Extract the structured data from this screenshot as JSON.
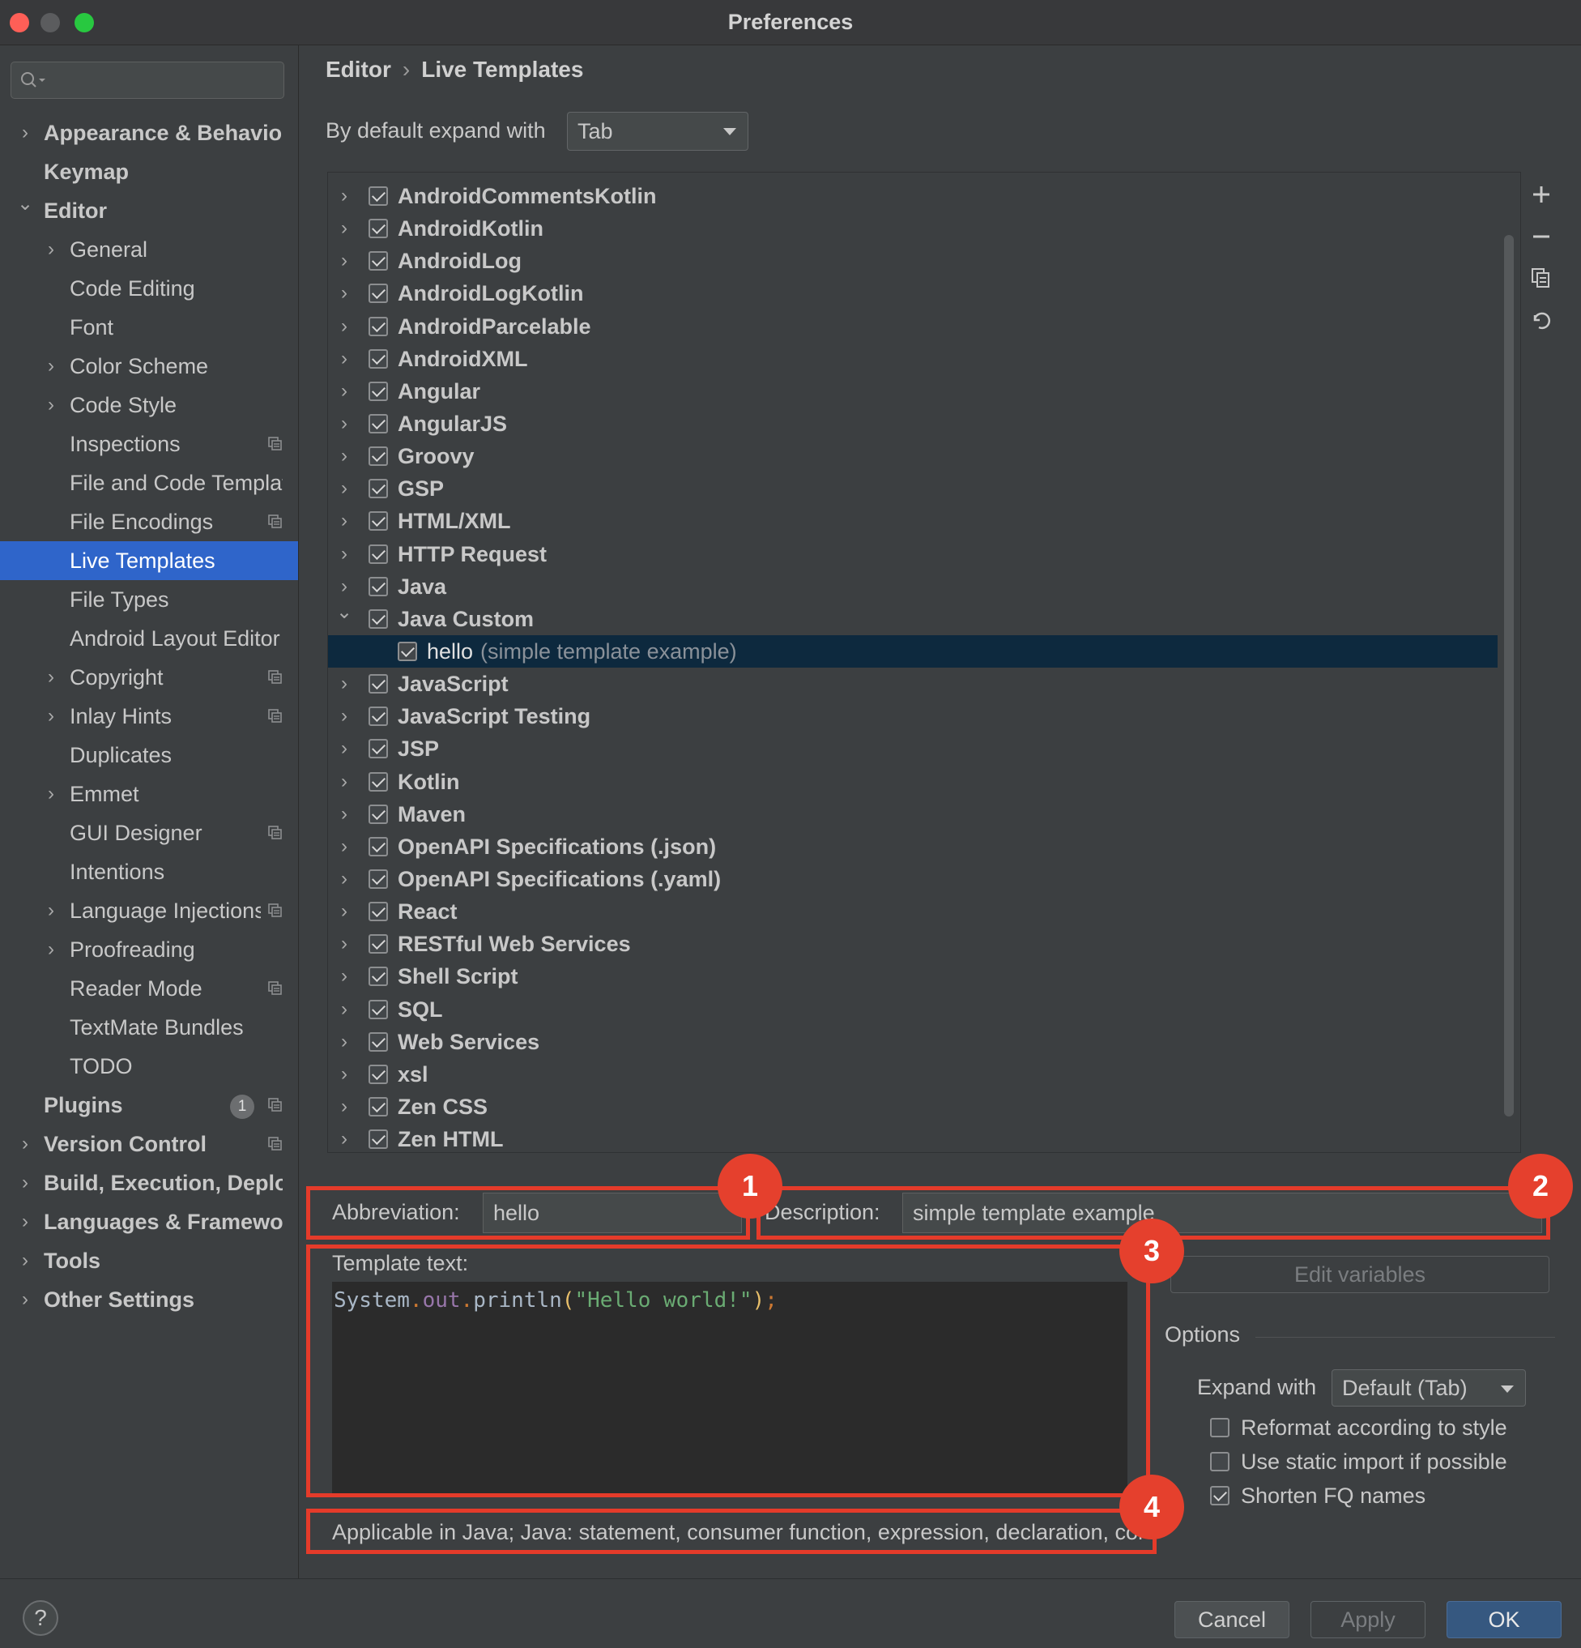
{
  "window": {
    "title": "Preferences",
    "colors": {
      "close": "#fe5f57",
      "minimize": "#febc2e",
      "maximize": "#28c840",
      "selection": "#2f65ca",
      "annotation": "#e53b2a",
      "primary_button": "#365880"
    }
  },
  "sidebar": {
    "search_placeholder": "",
    "items": [
      {
        "label": "Appearance & Behavior",
        "depth": 0,
        "bold": true,
        "chevron": "right"
      },
      {
        "label": "Keymap",
        "depth": 0,
        "bold": true
      },
      {
        "label": "Editor",
        "depth": 0,
        "bold": true,
        "chevron": "down"
      },
      {
        "label": "General",
        "depth": 1,
        "chevron": "right"
      },
      {
        "label": "Code Editing",
        "depth": 1
      },
      {
        "label": "Font",
        "depth": 1
      },
      {
        "label": "Color Scheme",
        "depth": 1,
        "chevron": "right"
      },
      {
        "label": "Code Style",
        "depth": 1,
        "chevron": "right"
      },
      {
        "label": "Inspections",
        "depth": 1,
        "icon": "project-settings-icon"
      },
      {
        "label": "File and Code Templates",
        "depth": 1
      },
      {
        "label": "File Encodings",
        "depth": 1,
        "icon": "project-settings-icon"
      },
      {
        "label": "Live Templates",
        "depth": 1,
        "selected": true
      },
      {
        "label": "File Types",
        "depth": 1
      },
      {
        "label": "Android Layout Editor",
        "depth": 1
      },
      {
        "label": "Copyright",
        "depth": 1,
        "chevron": "right",
        "icon": "project-settings-icon"
      },
      {
        "label": "Inlay Hints",
        "depth": 1,
        "chevron": "right",
        "icon": "project-settings-icon"
      },
      {
        "label": "Duplicates",
        "depth": 1
      },
      {
        "label": "Emmet",
        "depth": 1,
        "chevron": "right"
      },
      {
        "label": "GUI Designer",
        "depth": 1,
        "icon": "project-settings-icon"
      },
      {
        "label": "Intentions",
        "depth": 1
      },
      {
        "label": "Language Injections",
        "depth": 1,
        "chevron": "right",
        "icon": "project-settings-icon"
      },
      {
        "label": "Proofreading",
        "depth": 1,
        "chevron": "right"
      },
      {
        "label": "Reader Mode",
        "depth": 1,
        "icon": "project-settings-icon"
      },
      {
        "label": "TextMate Bundles",
        "depth": 1
      },
      {
        "label": "TODO",
        "depth": 1
      },
      {
        "label": "Plugins",
        "depth": 0,
        "bold": true,
        "badge": "1",
        "icon": "project-settings-icon"
      },
      {
        "label": "Version Control",
        "depth": 0,
        "bold": true,
        "chevron": "right",
        "icon": "project-settings-icon"
      },
      {
        "label": "Build, Execution, Deployment",
        "depth": 0,
        "bold": true,
        "chevron": "right"
      },
      {
        "label": "Languages & Frameworks",
        "depth": 0,
        "bold": true,
        "chevron": "right"
      },
      {
        "label": "Tools",
        "depth": 0,
        "bold": true,
        "chevron": "right"
      },
      {
        "label": "Other Settings",
        "depth": 0,
        "bold": true,
        "chevron": "right"
      }
    ]
  },
  "breadcrumb": {
    "parent": "Editor",
    "separator": "›",
    "current": "Live Templates"
  },
  "expand_default": {
    "label": "By default expand with",
    "value": "Tab"
  },
  "template_groups": [
    {
      "name": "AndroidCommentsKotlin",
      "checked": true
    },
    {
      "name": "AndroidKotlin",
      "checked": true
    },
    {
      "name": "AndroidLog",
      "checked": true
    },
    {
      "name": "AndroidLogKotlin",
      "checked": true
    },
    {
      "name": "AndroidParcelable",
      "checked": true
    },
    {
      "name": "AndroidXML",
      "checked": true
    },
    {
      "name": "Angular",
      "checked": true
    },
    {
      "name": "AngularJS",
      "checked": true
    },
    {
      "name": "Groovy",
      "checked": true
    },
    {
      "name": "GSP",
      "checked": true
    },
    {
      "name": "HTML/XML",
      "checked": true
    },
    {
      "name": "HTTP Request",
      "checked": true
    },
    {
      "name": "Java",
      "checked": true
    },
    {
      "name": "Java Custom",
      "checked": true,
      "expanded": true,
      "children": [
        {
          "abbr": "hello",
          "desc": "(simple template example)",
          "checked": true,
          "selected": true
        }
      ]
    },
    {
      "name": "JavaScript",
      "checked": true
    },
    {
      "name": "JavaScript Testing",
      "checked": true
    },
    {
      "name": "JSP",
      "checked": true
    },
    {
      "name": "Kotlin",
      "checked": true
    },
    {
      "name": "Maven",
      "checked": true
    },
    {
      "name": "OpenAPI Specifications (.json)",
      "checked": true
    },
    {
      "name": "OpenAPI Specifications (.yaml)",
      "checked": true
    },
    {
      "name": "React",
      "checked": true
    },
    {
      "name": "RESTful Web Services",
      "checked": true
    },
    {
      "name": "Shell Script",
      "checked": true
    },
    {
      "name": "SQL",
      "checked": true
    },
    {
      "name": "Web Services",
      "checked": true
    },
    {
      "name": "xsl",
      "checked": true
    },
    {
      "name": "Zen CSS",
      "checked": true
    },
    {
      "name": "Zen HTML",
      "checked": true
    }
  ],
  "toolbar_icons": [
    "plus-icon",
    "minus-icon",
    "copy-icon",
    "undo-icon"
  ],
  "editor": {
    "abbreviation_label": "Abbreviation:",
    "abbreviation": "hello",
    "description_label": "Description:",
    "description": "simple template example",
    "template_text_label": "Template text:",
    "code": {
      "prefix": "System",
      "dot1": ".",
      "mid": "out",
      "dot2": ".",
      "method": "println",
      "open": "(",
      "string": "\"Hello world!\"",
      "close": ")",
      "semi": ";"
    },
    "edit_variables": "Edit variables",
    "options_title": "Options",
    "expand_with_label": "Expand with",
    "expand_with_value": "Default (Tab)",
    "options": [
      {
        "label": "Reformat according to style",
        "checked": false
      },
      {
        "label": "Use static import if possible",
        "checked": false
      },
      {
        "label": "Shorten FQ names",
        "checked": true
      }
    ],
    "applicable": "Applicable in Java; Java: statement, consumer function, expression, declaration, comment"
  },
  "annotations": [
    "1",
    "2",
    "3",
    "4"
  ],
  "footer": {
    "help": "?",
    "cancel": "Cancel",
    "apply": "Apply",
    "ok": "OK"
  }
}
